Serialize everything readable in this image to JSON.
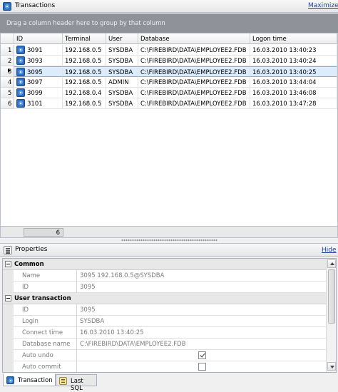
{
  "transactions_panel": {
    "title": "Transactions",
    "maximize_label": "Maximize",
    "group_hint": "Drag a column header here to group by that column",
    "columns": [
      "ID",
      "Terminal",
      "User",
      "Database",
      "Logon time"
    ],
    "rows": [
      {
        "num": "1",
        "id": "3091",
        "terminal": "192.168.0.5",
        "user": "SYSDBA",
        "database": "C:\\FIREBIRD\\DATA\\EMPLOYEE2.FDB",
        "logon": "16.03.2010 13:40:23"
      },
      {
        "num": "2",
        "id": "3093",
        "terminal": "192.168.0.5",
        "user": "SYSDBA",
        "database": "C:\\FIREBIRD\\DATA\\EMPLOYEE2.FDB",
        "logon": "16.03.2010 13:40:24"
      },
      {
        "num": "3",
        "id": "3095",
        "terminal": "192.168.0.5",
        "user": "SYSDBA",
        "database": "C:\\FIREBIRD\\DATA\\EMPLOYEE2.FDB",
        "logon": "16.03.2010 13:40:25"
      },
      {
        "num": "4",
        "id": "3097",
        "terminal": "192.168.0.5",
        "user": "ADMIN",
        "database": "C:\\FIREBIRD\\DATA\\EMPLOYEE2.FDB",
        "logon": "16.03.2010 13:44:04"
      },
      {
        "num": "5",
        "id": "3099",
        "terminal": "192.168.0.4",
        "user": "SYSDBA",
        "database": "C:\\FIREBIRD\\DATA\\EMPLOYEE2.FDB",
        "logon": "16.03.2010 13:46:08"
      },
      {
        "num": "6",
        "id": "3101",
        "terminal": "192.168.0.5",
        "user": "SYSDBA",
        "database": "C:\\FIREBIRD\\DATA\\EMPLOYEE2.FDB",
        "logon": "16.03.2010 13:47:28"
      }
    ],
    "selected_row": 3,
    "record_count": "6"
  },
  "properties_panel": {
    "title": "Properties",
    "hide_label": "Hide",
    "common": {
      "label": "Common",
      "name_label": "Name",
      "name_value": "3095 192.168.0.5@SYSDBA",
      "id_label": "ID",
      "id_value": "3095"
    },
    "user_transaction": {
      "label": "User transaction",
      "id_label": "ID",
      "id_value": "3095",
      "login_label": "Login",
      "login_value": "SYSDBA",
      "connect_label": "Connect time",
      "connect_value": "16.03.2010 13:40:25",
      "dbname_label": "Database name",
      "dbname_value": "C:\\FIREBIRD\\DATA\\EMPLOYEE2.FDB",
      "autoundo_label": "Auto undo",
      "autoundo_checked": true,
      "autocommit_label": "Auto commit",
      "autocommit_checked": false
    }
  },
  "bottom_tabs": {
    "transaction_label": "Transaction",
    "lastsql_label": "Last SQL",
    "active": "Transaction"
  },
  "icons": {
    "panel": "database-icon",
    "row": "transaction-icon",
    "properties": "properties-icon",
    "sql": "sql-icon"
  },
  "colors": {
    "selected_row": "#dcecfc",
    "link": "#1f3fa8",
    "group_panel": "#8f9298"
  }
}
